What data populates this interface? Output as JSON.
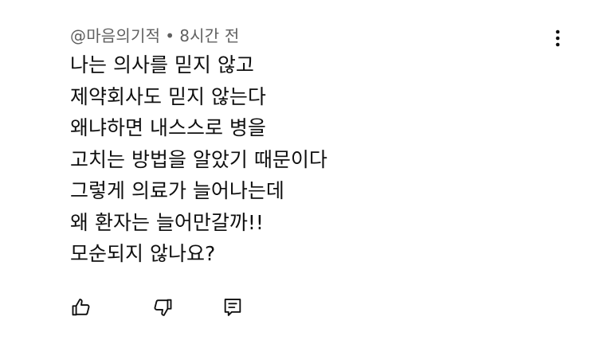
{
  "comment": {
    "author": "@마음의기적",
    "separator": "•",
    "time": "8시간 전",
    "lines": [
      "나는 의사를 믿지 않고",
      "제약회사도 믿지 않는다",
      "왜냐하면  내스스로 병을",
      "고치는 방법을 알았기 때문이다",
      "그렇게 의료가 늘어나는데",
      "왜 환자는 늘어만갈까!!",
      "모순되지 않나요?"
    ]
  },
  "icons": {
    "menu": "more-vert-icon",
    "like": "thumbs-up-icon",
    "dislike": "thumbs-down-icon",
    "reply": "reply-comment-icon"
  },
  "colors": {
    "text": "#0f0f0f",
    "meta": "#606060"
  }
}
